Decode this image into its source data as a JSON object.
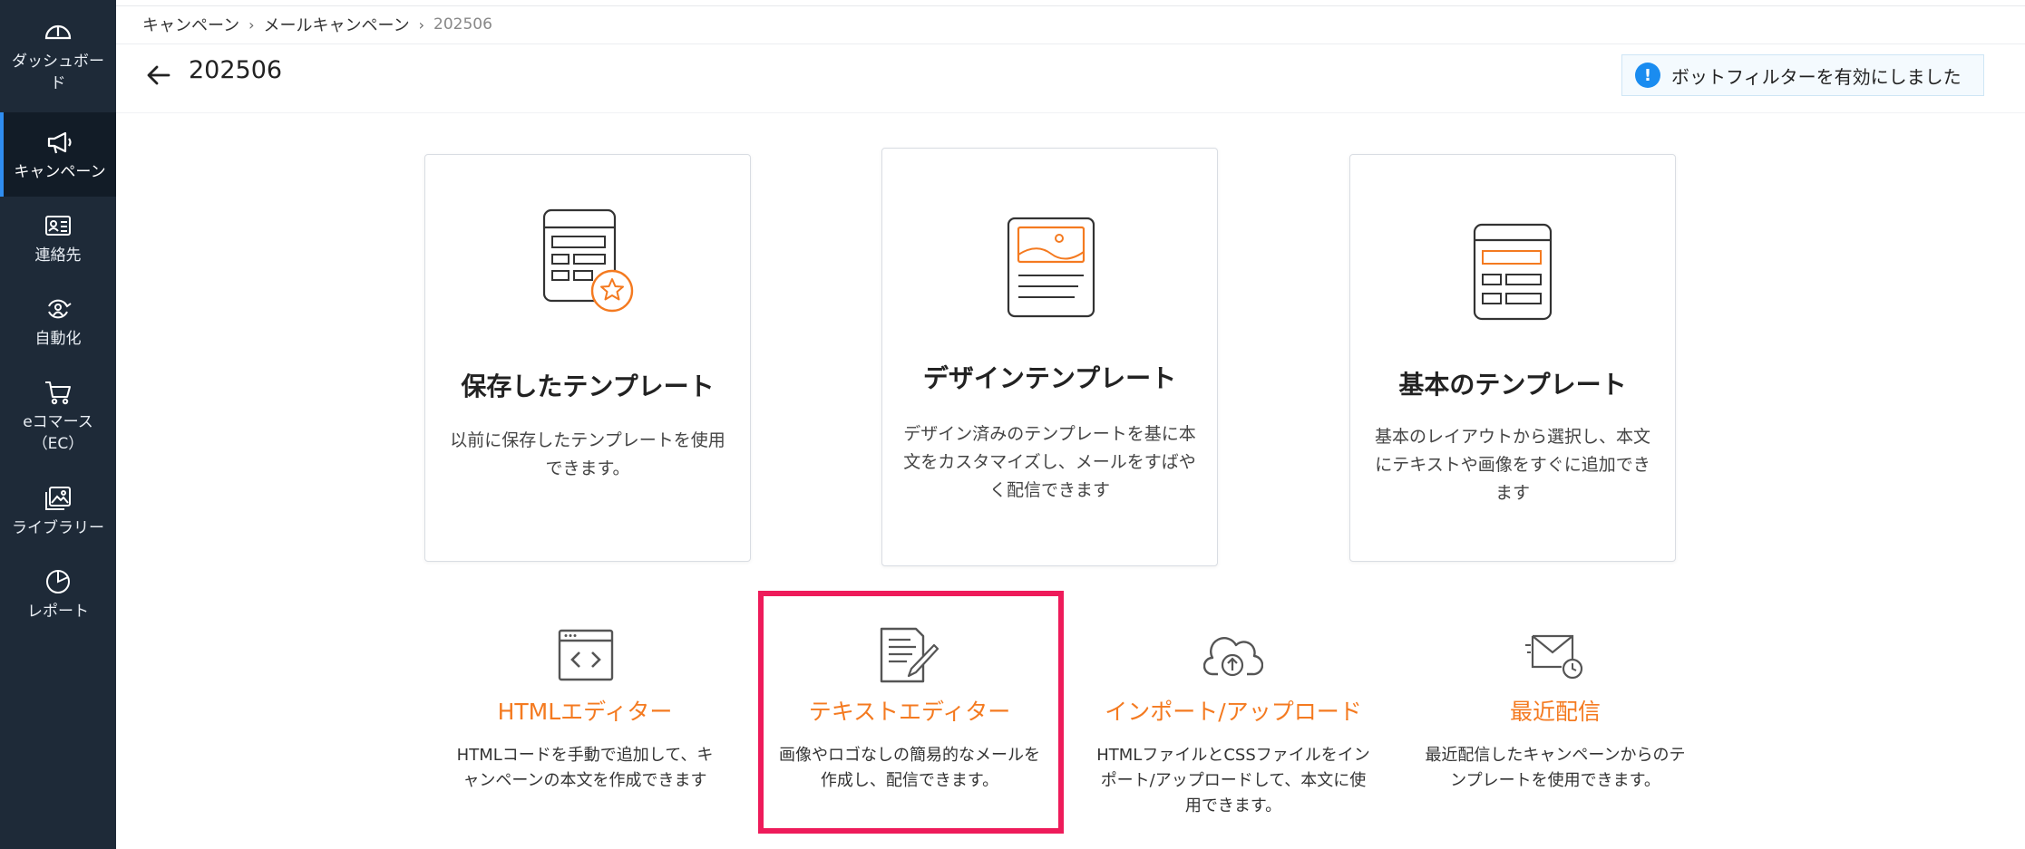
{
  "sidebar": {
    "items": [
      {
        "label": "ダッシュボード",
        "icon": "gauge-icon"
      },
      {
        "label": "キャンペーン",
        "icon": "megaphone-icon",
        "active": true
      },
      {
        "label": "連絡先",
        "icon": "contact-card-icon"
      },
      {
        "label": "自動化",
        "icon": "automation-icon"
      },
      {
        "label": "eコマース（EC）",
        "icon": "cart-icon"
      },
      {
        "label": "ライブラリー",
        "icon": "image-library-icon"
      },
      {
        "label": "レポート",
        "icon": "pie-chart-icon"
      }
    ]
  },
  "breadcrumb": {
    "items": [
      "キャンペーン",
      "メールキャンペーン",
      "202506"
    ],
    "separator": "›"
  },
  "header": {
    "title": "202506",
    "notice": "ボットフィルターを有効にしました"
  },
  "templates": [
    {
      "title": "保存したテンプレート",
      "desc": "以前に保存したテンプレートを使用できます。"
    },
    {
      "title": "デザインテンプレート",
      "desc": "デザイン済みのテンプレートを基に本文をカスタマイズし、メールをすばやく配信できます"
    },
    {
      "title": "基本のテンプレート",
      "desc": "基本のレイアウトから選択し、本文にテキストや画像をすぐに追加できます"
    }
  ],
  "options": [
    {
      "title": "HTMLエディター",
      "desc": "HTMLコードを手動で追加して、キャンペーンの本文を作成できます"
    },
    {
      "title": "テキストエディター",
      "desc": "画像やロゴなしの簡易的なメールを作成し、配信できます。"
    },
    {
      "title": "インポート/アップロード",
      "desc": "HTMLファイルとCSSファイルをインポート/アップロードして、本文に使用できます。"
    },
    {
      "title": "最近配信",
      "desc": "最近配信したキャンペーンからのテンプレートを使用できます。"
    }
  ],
  "colors": {
    "sidebar_bg": "#1e2a38",
    "accent_orange": "#f47a20",
    "highlight_pink": "#ee1b5a",
    "info_blue": "#1a8cf0"
  }
}
